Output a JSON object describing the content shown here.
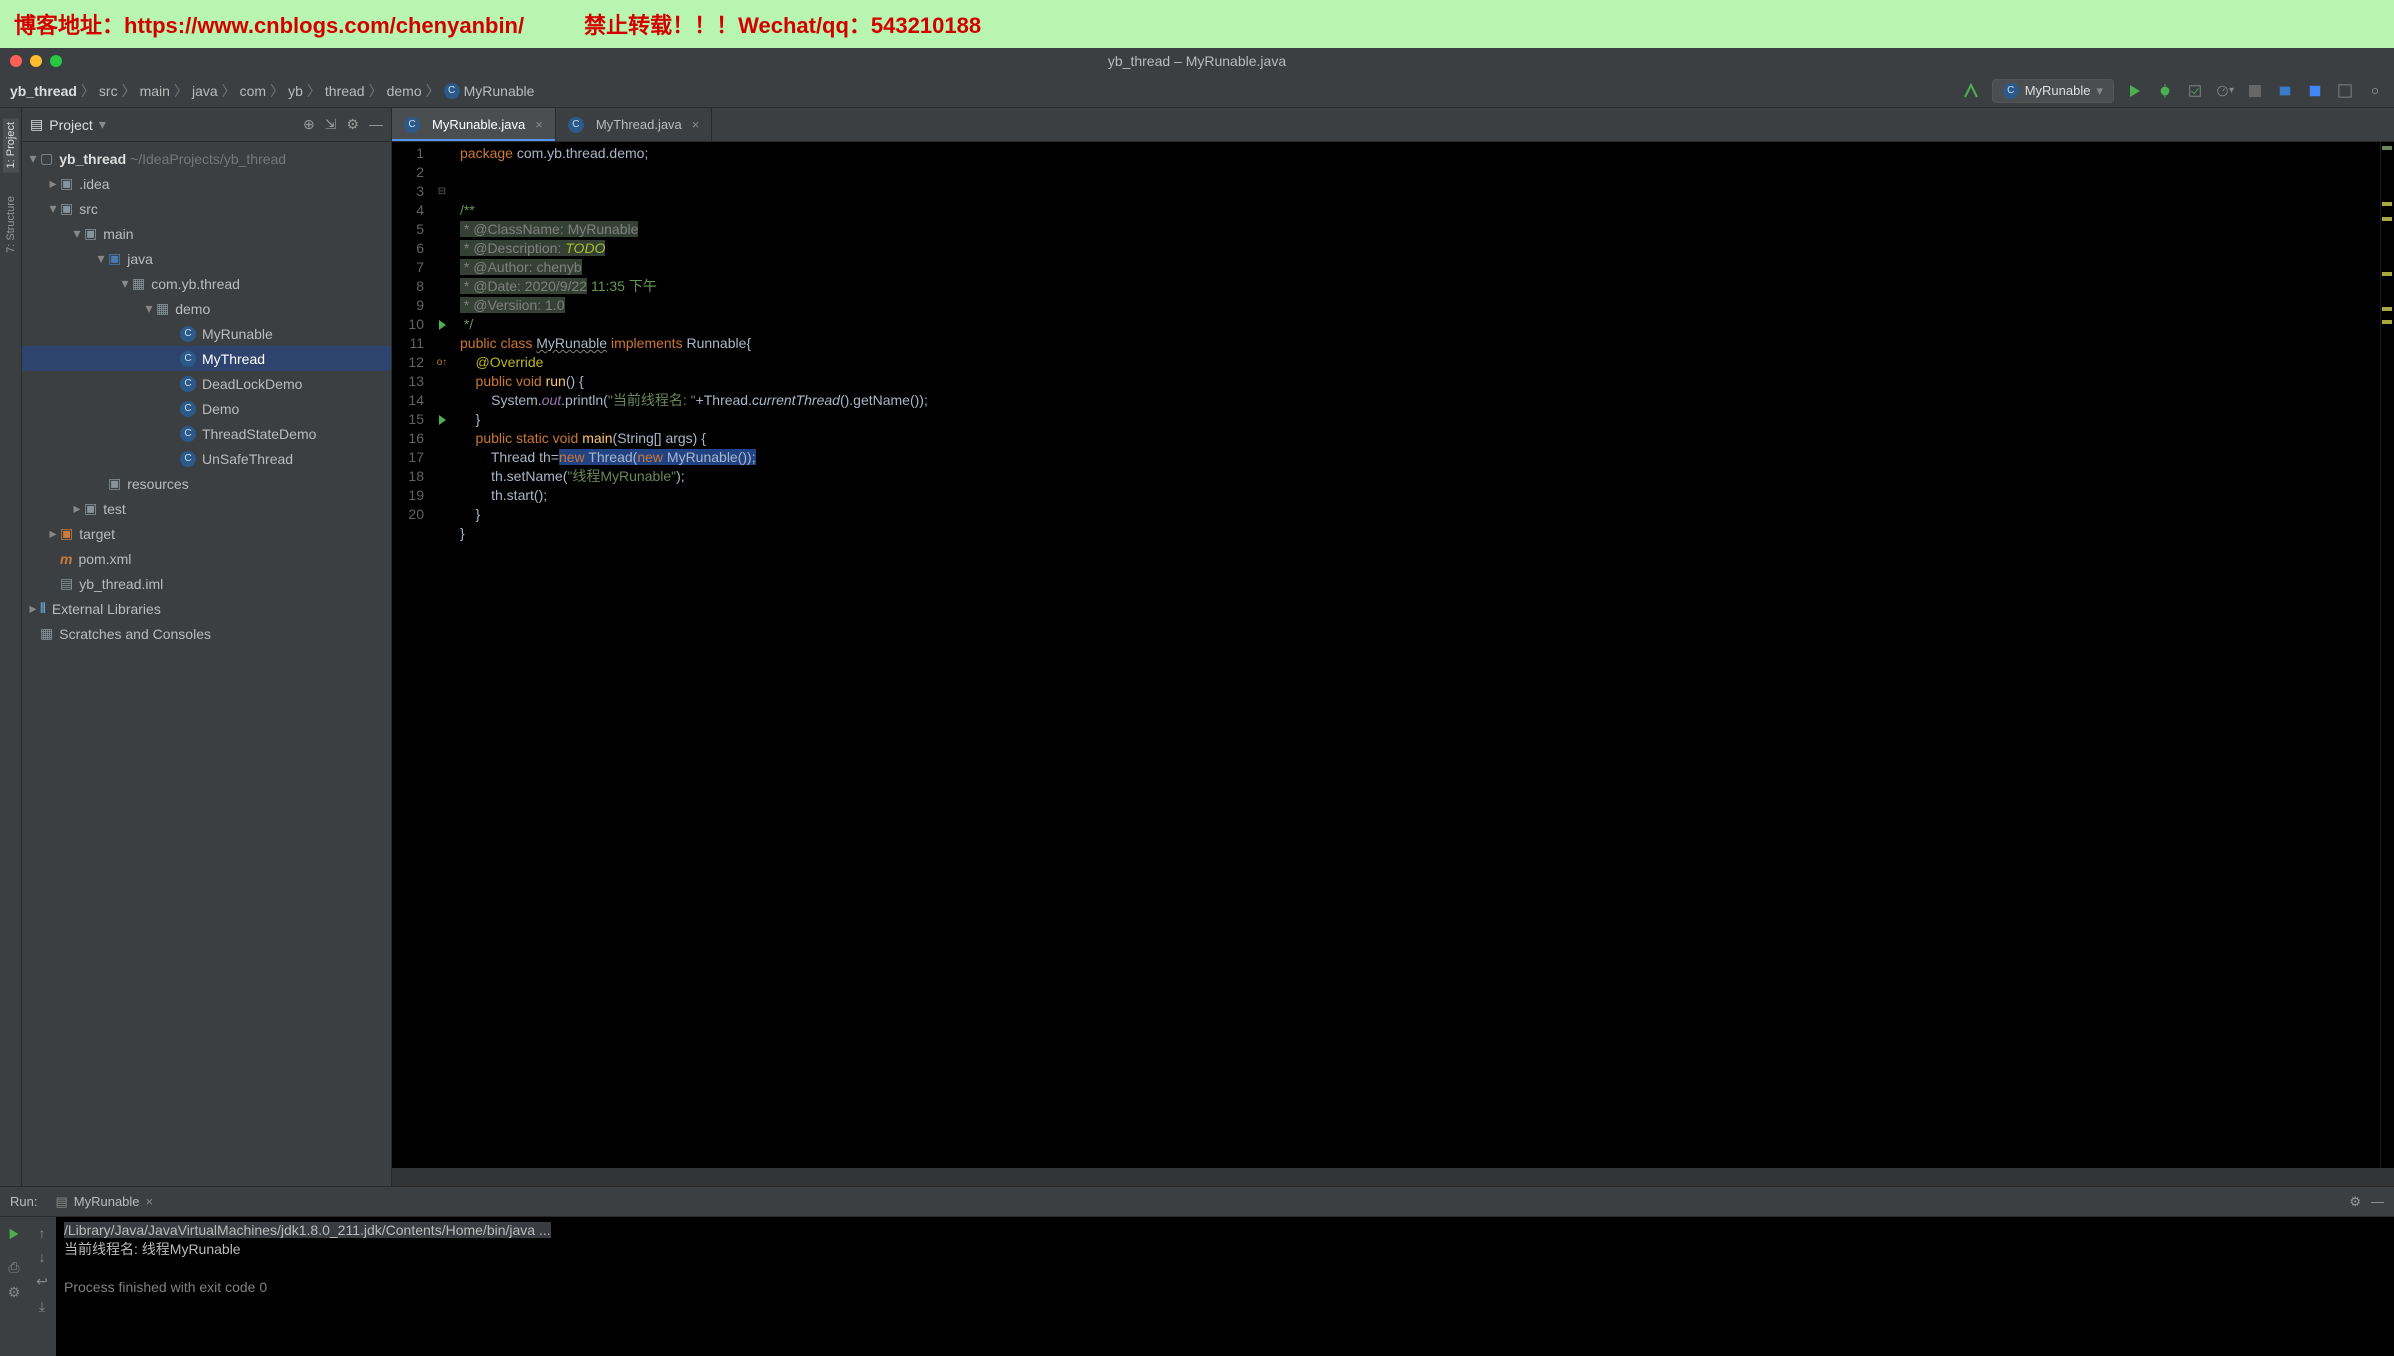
{
  "banner": {
    "blog_label": "博客地址：https://www.cnblogs.com/chenyanbin/",
    "notice": "禁止转载！！！Wechat/qq：543210188"
  },
  "window_title": "yb_thread – MyRunable.java",
  "breadcrumbs": [
    "yb_thread",
    "src",
    "main",
    "java",
    "com",
    "yb",
    "thread",
    "demo",
    "MyRunable"
  ],
  "run_config_selected": "MyRunable",
  "sidebar": {
    "title": "Project",
    "tree": {
      "root_name": "yb_thread",
      "root_path": "~/IdeaProjects/yb_thread",
      "idea": ".idea",
      "src": "src",
      "main": "main",
      "java": "java",
      "pkg": "com.yb.thread",
      "demo": "demo",
      "files": [
        "MyRunable",
        "MyThread",
        "DeadLockDemo",
        "Demo",
        "ThreadStateDemo",
        "UnSafeThread"
      ],
      "resources": "resources",
      "test": "test",
      "target": "target",
      "pom": "pom.xml",
      "iml": "yb_thread.iml",
      "external": "External Libraries",
      "scratches": "Scratches and Consoles"
    }
  },
  "tool_tabs": {
    "project": "1: Project",
    "structure": "7: Structure"
  },
  "editor_tabs": [
    {
      "name": "MyRunable.java",
      "active": true
    },
    {
      "name": "MyThread.java",
      "active": false
    }
  ],
  "code_lines": {
    "count": 20,
    "l1a": "package ",
    "l1b": "com.yb.thread.demo;",
    "l3": "/**",
    "l4": " * @ClassName: MyRunable",
    "l5a": " * @Description: ",
    "l5b": "TODO",
    "l6": " * @Author: chenyb",
    "l7a": " * @Date: 2020/9/22",
    "l7b": " 11:35 下午",
    "l8": " * @Versiion: 1.0",
    "l9": " */",
    "l10_public": "public ",
    "l10_class": "class ",
    "l10_name": "MyRunable",
    "l10_impl": " implements ",
    "l10_iface": "Runnable",
    "l10_open": "{",
    "l11": "    @Override",
    "l12a": "    public ",
    "l12b": "void ",
    "l12c": "run",
    "l12d": "() {",
    "l13a": "        System.",
    "l13b": "out",
    "l13c": ".println(",
    "l13d": "\"当前线程名: \"",
    "l13e": "+Thread.",
    "l13f": "currentThread",
    "l13g": "().getName());",
    "l14": "    }",
    "l15a": "    public ",
    "l15b": "static ",
    "l15c": "void ",
    "l15d": "main",
    "l15e": "(String[] args) {",
    "l16a": "        Thread th=",
    "l16b": "new ",
    "l16c": "Thread(",
    "l16d": "new ",
    "l16e": "MyRunable());",
    "l17a": "        th.setName(",
    "l17b": "\"线程MyRunable\"",
    "l17c": ");",
    "l18": "        th.start();",
    "l19": "    }",
    "l20": "}"
  },
  "run_panel": {
    "label": "Run:",
    "tab_name": "MyRunable",
    "console": {
      "cmd": "/Library/Java/JavaVirtualMachines/jdk1.8.0_211.jdk/Contents/Home/bin/java ...",
      "output": "当前线程名: 线程MyRunable",
      "exit": "Process finished with exit code 0"
    }
  }
}
